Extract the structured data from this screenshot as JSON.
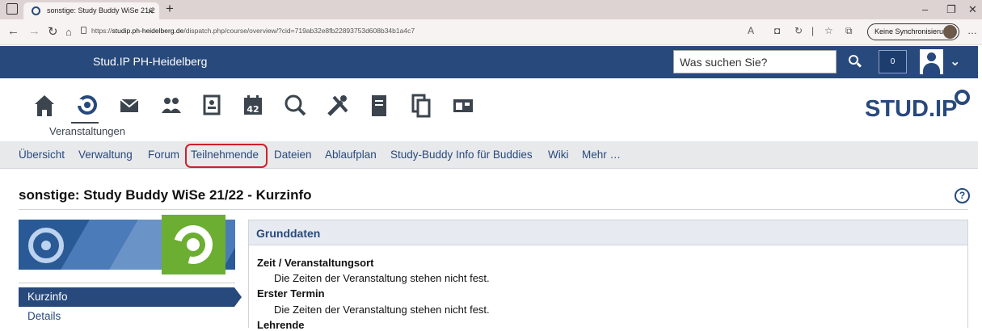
{
  "browser": {
    "tab_title": "sonstige: Study Buddy WiSe 21/2",
    "url_prefix": "https://",
    "url_host": "studip.ph-heidelberg.de",
    "url_path": "/dispatch.php/course/overview/?cid=719ab32e8fb22893753d608b34b1a4c7",
    "sync_label": "Keine Synchronisierung"
  },
  "header": {
    "brand": "Stud.IP PH-Heidelberg",
    "search_placeholder": "Was suchen Sie?",
    "notification_count": "0"
  },
  "mainnav": {
    "active_label": "Veranstaltungen",
    "icons": [
      "home-icon",
      "courses-icon",
      "mail-icon",
      "community-icon",
      "profile-icon",
      "calendar-icon",
      "search-icon",
      "tools-icon",
      "files-icon",
      "documents-icon",
      "admin-icon"
    ],
    "calendar_day": "42"
  },
  "logo": {
    "text": "STUD.IP"
  },
  "subnav": {
    "items": [
      "Übersicht",
      "Verwaltung",
      "Forum",
      "Teilnehmende",
      "Dateien",
      "Ablaufplan",
      "Study-Buddy Info für Buddies",
      "Wiki",
      "Mehr …"
    ],
    "highlighted": "Teilnehmende"
  },
  "page": {
    "title": "sonstige: Study Buddy WiSe 21/22 - Kurzinfo",
    "help": "?"
  },
  "sidebar": {
    "items": [
      {
        "label": "Kurzinfo",
        "active": true
      },
      {
        "label": "Details",
        "active": false
      }
    ]
  },
  "grunddaten": {
    "heading": "Grunddaten",
    "rows": [
      {
        "term": "Zeit / Veranstaltungsort",
        "value": "Die Zeiten der Veranstaltung stehen nicht fest."
      },
      {
        "term": "Erster Termin",
        "value": "Die Zeiten der Veranstaltung stehen nicht fest."
      },
      {
        "term": "Lehrende",
        "value": ""
      }
    ]
  },
  "colors": {
    "brand": "#28497c",
    "highlight": "#d0202a",
    "green": "#6bae32"
  }
}
